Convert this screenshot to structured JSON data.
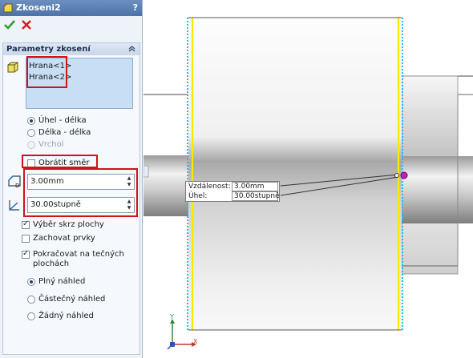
{
  "title": "Zkoseni2",
  "help": "?",
  "group": {
    "header": "Parametry zkosení",
    "edges": [
      "Hrana<1>",
      "Hrana<2>"
    ],
    "chamfer_type_options": [
      {
        "label": "Úhel - délka",
        "selected": true,
        "enabled": true
      },
      {
        "label": "Délka - délka",
        "selected": false,
        "enabled": true
      },
      {
        "label": "Vrchol",
        "selected": false,
        "enabled": false
      }
    ],
    "flip_direction": {
      "label": "Obrátit směr",
      "checked": false
    },
    "distance_value": "3.00mm",
    "angle_value": "30.00stupně",
    "checks": [
      {
        "label": "Výběr skrz plochy",
        "checked": true
      },
      {
        "label": "Zachovat prvky",
        "checked": false
      },
      {
        "label": "Pokračovat na tečných",
        "label2": "plochách",
        "checked": true
      }
    ],
    "preview_options": [
      {
        "label": "Plný náhled",
        "selected": true
      },
      {
        "label": "Částečný náhled",
        "selected": false
      },
      {
        "label": "Žádný náhled",
        "selected": false
      }
    ]
  },
  "callout": {
    "distance_label": "Vzdálenost:",
    "distance_value": "3.00mm",
    "angle_label": "Úhel:",
    "angle_value": "30.00stupně"
  },
  "axes": {
    "x": "X",
    "y": "Y"
  },
  "colors": {
    "highlight_red": "#d0121b",
    "edge_yellow": "#ffe600",
    "edge_cyan": "#29b6f6",
    "handle_magenta": "#c020c0",
    "title_blue": "#5a7fb5"
  }
}
